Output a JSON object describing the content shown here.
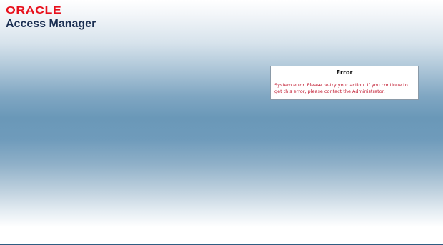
{
  "brand": {
    "logo_text": "ORACLE",
    "product_name": "Access Manager"
  },
  "error": {
    "title": "Error",
    "message": "System error. Please re-try your action. If you continue to get this error, please contact the Administrator."
  },
  "colors": {
    "logo_red": "#e8101c",
    "product_navy": "#1b2f52",
    "error_text": "#c0182e"
  }
}
